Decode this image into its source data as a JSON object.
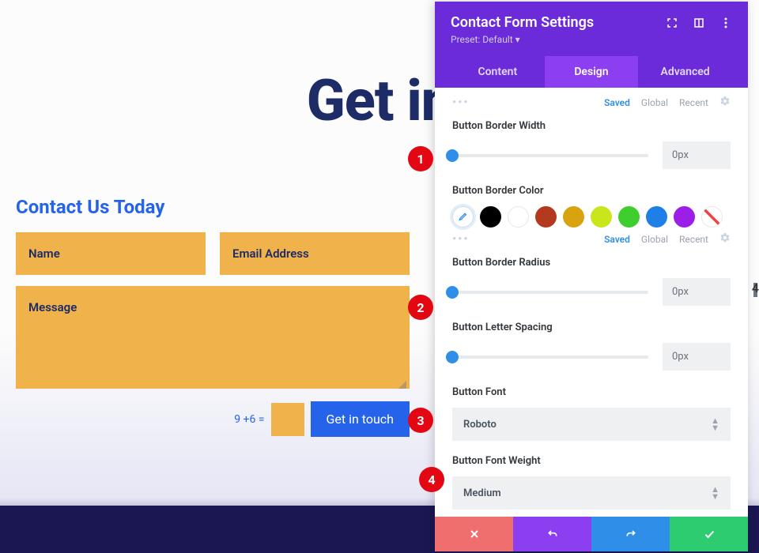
{
  "page": {
    "headline": "Get in",
    "contact_heading": "Contact Us Today",
    "name_ph": "Name",
    "email_ph": "Email Address",
    "message_ph": "Message",
    "captcha_q": "9 +6 =",
    "submit": "Get in touch"
  },
  "panel": {
    "title": "Contact Form Settings",
    "preset": "Preset: Default ▾",
    "tabs": {
      "content": "Content",
      "design": "Design",
      "advanced": "Advanced"
    },
    "history": {
      "saved": "Saved",
      "global": "Global",
      "recent": "Recent"
    },
    "controls": {
      "border_width": {
        "label": "Button Border Width",
        "value": "0px"
      },
      "border_color": {
        "label": "Button Border Color"
      },
      "border_radius": {
        "label": "Button Border Radius",
        "value": "0px"
      },
      "letter_spacing": {
        "label": "Button Letter Spacing",
        "value": "0px"
      },
      "font": {
        "label": "Button Font",
        "value": "Roboto"
      },
      "font_weight": {
        "label": "Button Font Weight",
        "value": "Medium"
      }
    },
    "swatches": [
      "#000000",
      "#ffffff",
      "#b33a1e",
      "#d9a310",
      "#c8e61b",
      "#3ecf2f",
      "#1e7fe6",
      "#9b1fe6"
    ]
  },
  "annotations": {
    "b1": "1",
    "b2": "2",
    "b3": "3",
    "b4": "4",
    "side4": "4"
  }
}
